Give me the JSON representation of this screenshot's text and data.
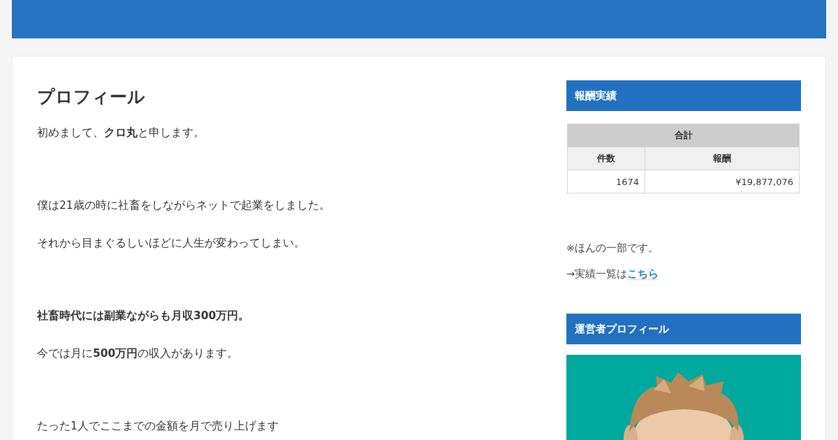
{
  "article": {
    "title": "プロフィール",
    "sections": [
      {
        "paragraphs": [
          {
            "text": "初めまして、**クロ丸**と申します。",
            "bold": false
          }
        ]
      },
      {
        "paragraphs": [
          {
            "text": "僕は21歳の時に社畜をしながらネットで起業をしました。",
            "bold": false
          },
          {
            "text": "それから目まぐるしいほどに人生が変わってしまい。",
            "bold": false
          }
        ]
      },
      {
        "paragraphs": [
          {
            "text": "社畜時代には副業ながらも月収300万円。",
            "bold": true
          },
          {
            "text": "今では月に**500万円**の収入があります。",
            "bold": false
          }
        ]
      },
      {
        "paragraphs": [
          {
            "text": "たった1人でここまでの金額を月で売り上げます",
            "bold": false
          }
        ]
      }
    ]
  },
  "sidebar": {
    "widgets": [
      {
        "kind": "table",
        "title": "報酬実績",
        "table": {
          "caption": "合計",
          "columns": [
            "件数",
            "報酬"
          ],
          "rows": [
            [
              "1674",
              "¥19,877,076"
            ]
          ]
        },
        "note": "※ほんの一部です。",
        "link_prefix": "→実績一覧は",
        "link": "こちら"
      },
      {
        "kind": "picture",
        "title": "運営者プロフィール"
      }
    ]
  }
}
